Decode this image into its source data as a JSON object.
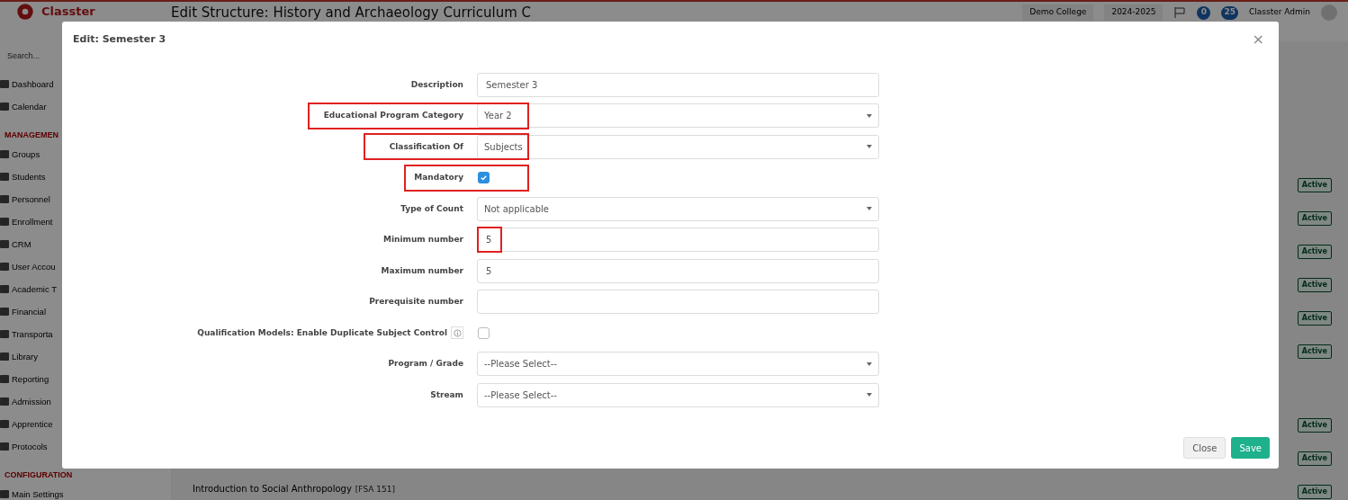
{
  "app": {
    "logo_text": "Classter",
    "page_title": "Edit Structure: History and Archaeology Curriculum C",
    "institution": "Demo College",
    "year": "2024-2025",
    "notification_count": "0",
    "message_count": "25",
    "user": "Classter Admin",
    "search_placeholder": "Search..."
  },
  "sidebar": {
    "items": [
      {
        "label": "Dashboard",
        "kind": "item"
      },
      {
        "label": "Calendar",
        "kind": "item"
      },
      {
        "label": "MANAGEMEN",
        "kind": "heading"
      },
      {
        "label": "Groups",
        "kind": "item"
      },
      {
        "label": "Students",
        "kind": "item"
      },
      {
        "label": "Personnel",
        "kind": "item"
      },
      {
        "label": "Enrollment",
        "kind": "item"
      },
      {
        "label": "CRM",
        "kind": "item"
      },
      {
        "label": "User Accou",
        "kind": "item"
      },
      {
        "label": "Academic T",
        "kind": "item"
      },
      {
        "label": "Financial",
        "kind": "item"
      },
      {
        "label": "Transporta",
        "kind": "item"
      },
      {
        "label": "Library",
        "kind": "item"
      },
      {
        "label": "Reporting",
        "kind": "item"
      },
      {
        "label": "Admission",
        "kind": "item"
      },
      {
        "label": "Apprentice",
        "kind": "item"
      },
      {
        "label": "Protocols",
        "kind": "item"
      },
      {
        "label": "CONFIGURATION",
        "kind": "heading"
      },
      {
        "label": "Main Settings",
        "kind": "item"
      }
    ]
  },
  "background_list": {
    "status_badges": [
      "Active",
      "Active",
      "Active",
      "Active",
      "Active",
      "Active",
      "Active",
      "Active",
      "Active"
    ],
    "last_row": {
      "name": "Introduction to Social Anthropology",
      "code": "[FSA 151]"
    }
  },
  "modal": {
    "title": "Edit: Semester 3",
    "close_symbol": "×",
    "fields": [
      {
        "label": "Description",
        "kind": "text",
        "value": "Semester 3",
        "highlighted": false
      },
      {
        "label": "Educational Program Category",
        "kind": "select",
        "value": "Year 2",
        "highlighted": true
      },
      {
        "label": "Classification Of",
        "kind": "select",
        "value": "Subjects",
        "highlighted": true
      },
      {
        "label": "Mandatory",
        "kind": "checkbox",
        "checked": true,
        "highlighted": true
      },
      {
        "label": "Type of Count",
        "kind": "select",
        "value": "Not applicable",
        "highlighted": false
      },
      {
        "label": "Minimum number",
        "kind": "text",
        "value": "5",
        "highlighted": true
      },
      {
        "label": "Maximum number",
        "kind": "text",
        "value": "5",
        "highlighted": false
      },
      {
        "label": "Prerequisite number",
        "kind": "text",
        "highlighted": false
      },
      {
        "label": "Qualification Models: Enable Duplicate Subject Control",
        "kind": "checkbox",
        "checked": false,
        "info": true,
        "highlighted": false
      },
      {
        "label": "Program / Grade",
        "kind": "select",
        "value": "--Please Select--",
        "highlighted": false
      },
      {
        "label": "Stream",
        "kind": "select",
        "value": "--Please Select--",
        "highlighted": false
      }
    ],
    "buttons": [
      {
        "label": "Close",
        "kind": "secondary"
      },
      {
        "label": "Save",
        "kind": "primary"
      }
    ]
  }
}
